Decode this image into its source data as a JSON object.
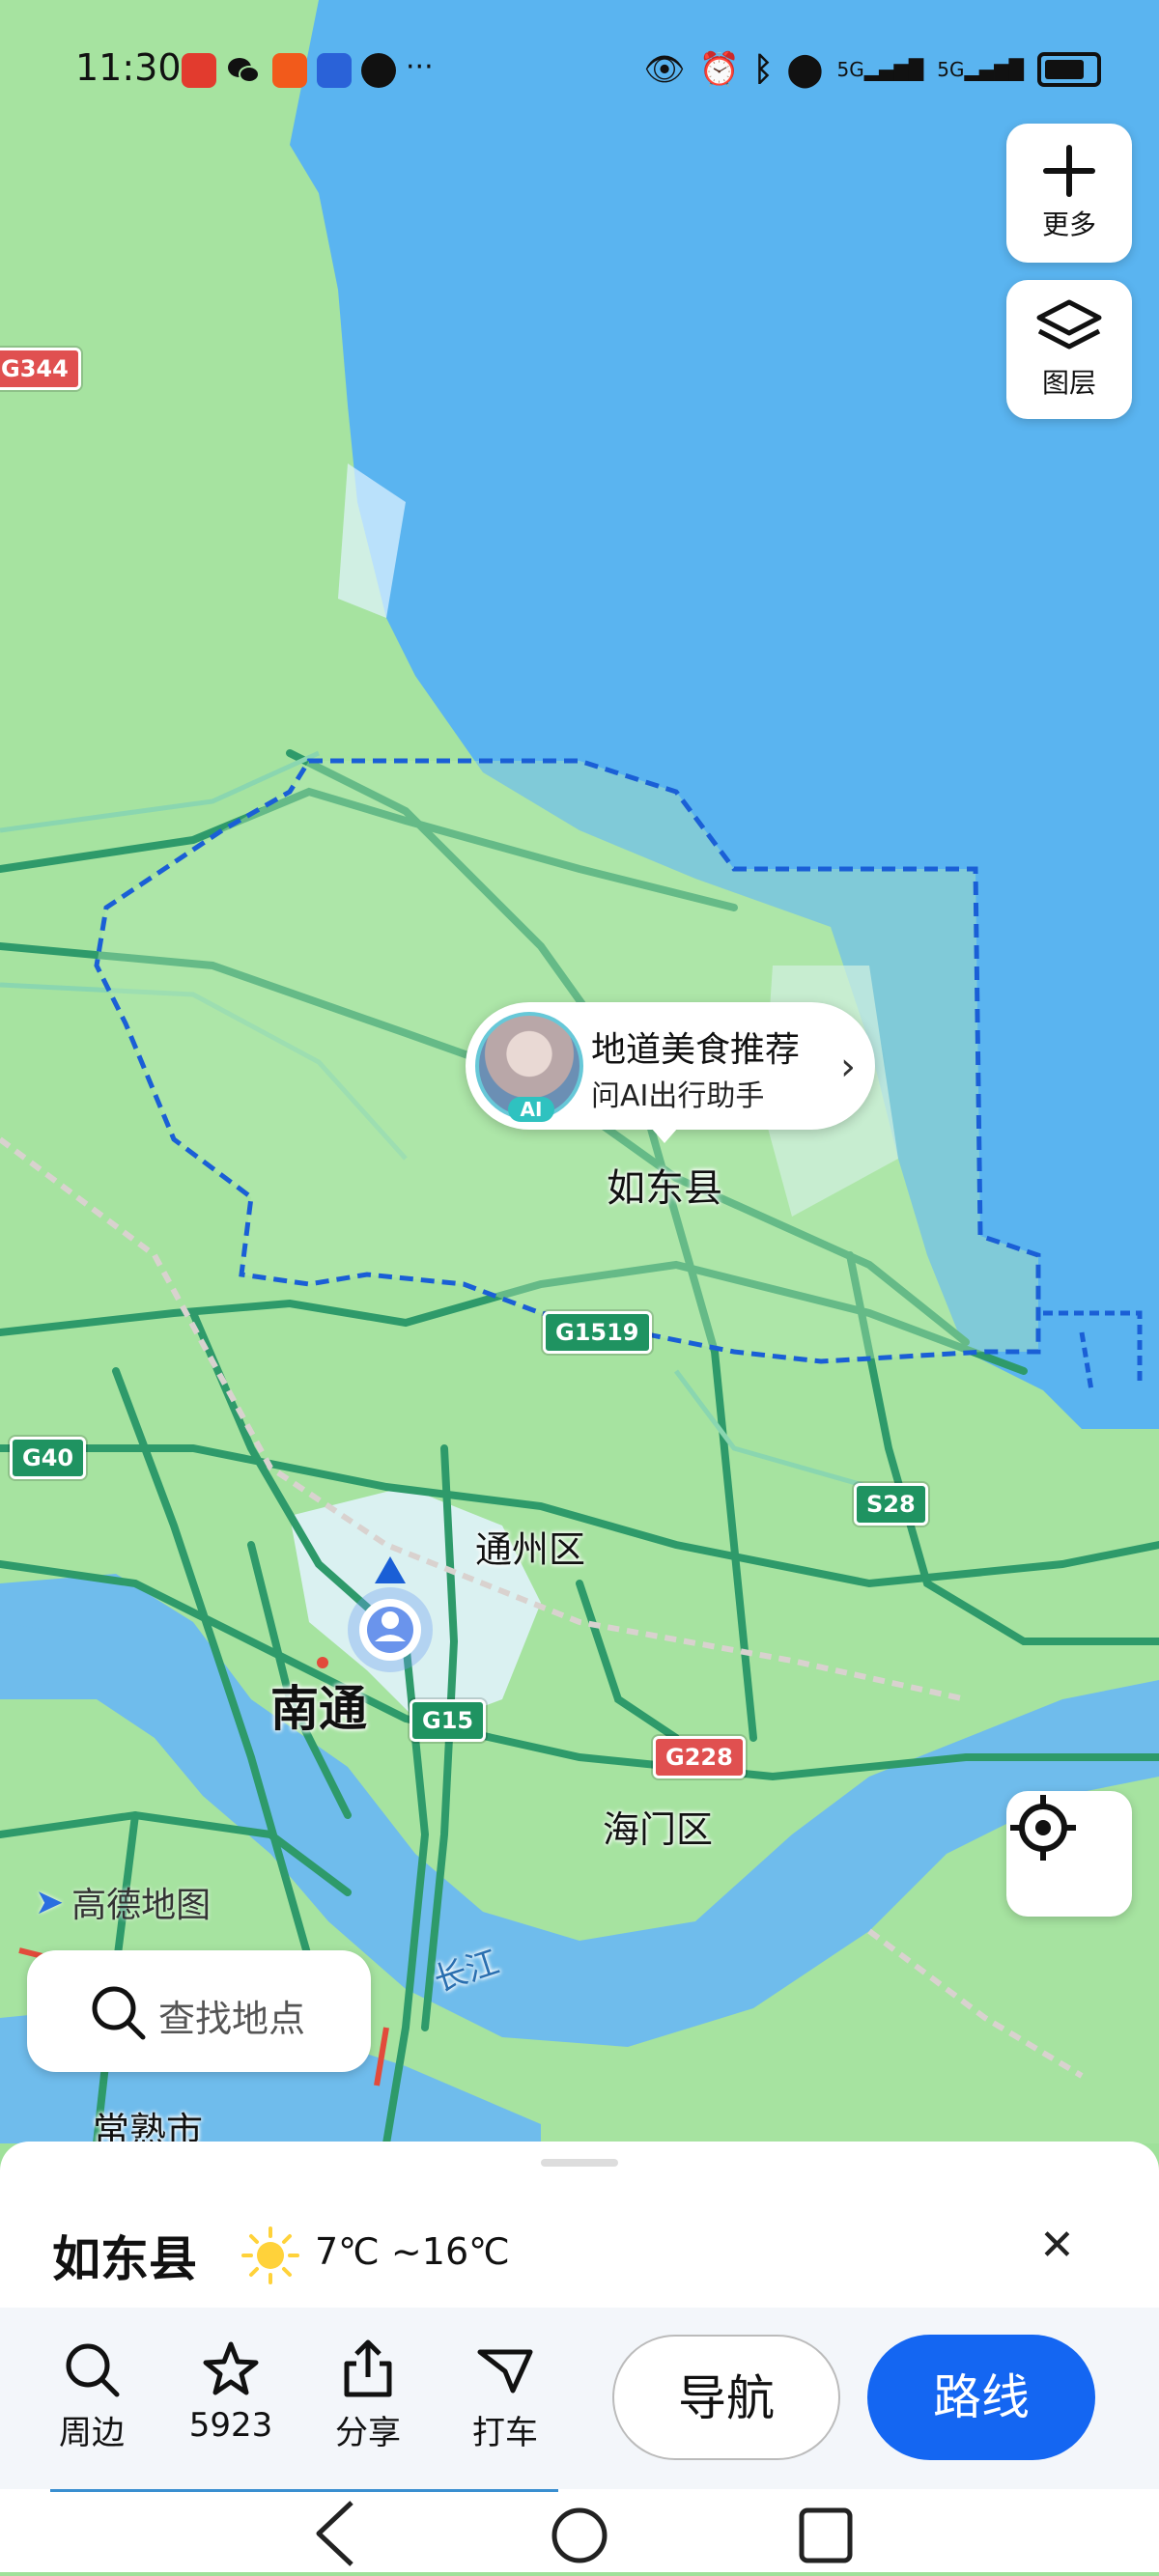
{
  "status_bar": {
    "time": "11:30",
    "left_icons": [
      "weibo-icon",
      "wechat-icon",
      "taobao-icon",
      "robot-app-icon",
      "chat-bubble-icon"
    ],
    "more": "···",
    "right_icons": [
      "eye-icon",
      "alarm-icon",
      "bluetooth-icon",
      "location-icon",
      "signal-5g-icon",
      "signal-5g-icon",
      "battery-icon"
    ],
    "signal_label": "5G"
  },
  "map_controls": {
    "more_label": "更多",
    "layers_label": "图层"
  },
  "ai_bubble": {
    "title": "地道美食推荐",
    "subtitle": "问AI出行助手",
    "badge": "AI"
  },
  "map_labels": {
    "rudong": "如东县",
    "tongzhou": "通州区",
    "nantong": "南通",
    "haimen": "海门区",
    "changjiang": "长江",
    "changshu": "常熟市"
  },
  "road_shields": {
    "g344": "G344",
    "g1519": "G1519",
    "g40": "G40",
    "s28": "S28",
    "g15": "G15",
    "g228": "G228"
  },
  "brand": "高德地图",
  "search": {
    "placeholder": "查找地点"
  },
  "place_card": {
    "name": "如东县",
    "weather": "7℃ ~16℃",
    "weather_icon": "sun-icon",
    "actions": [
      {
        "label": "周边",
        "icon": "search-icon"
      },
      {
        "label": "5923",
        "icon": "star-icon"
      },
      {
        "label": "分享",
        "icon": "share-icon"
      },
      {
        "label": "打车",
        "icon": "taxi-icon"
      }
    ],
    "navigate_label": "导航",
    "route_label": "路线"
  },
  "colors": {
    "sea": "#5ab4f0",
    "land": "#a6e3a0",
    "highway": "#2e9a6a",
    "boundary": "#1a5fd6",
    "accent": "#1466f2"
  }
}
